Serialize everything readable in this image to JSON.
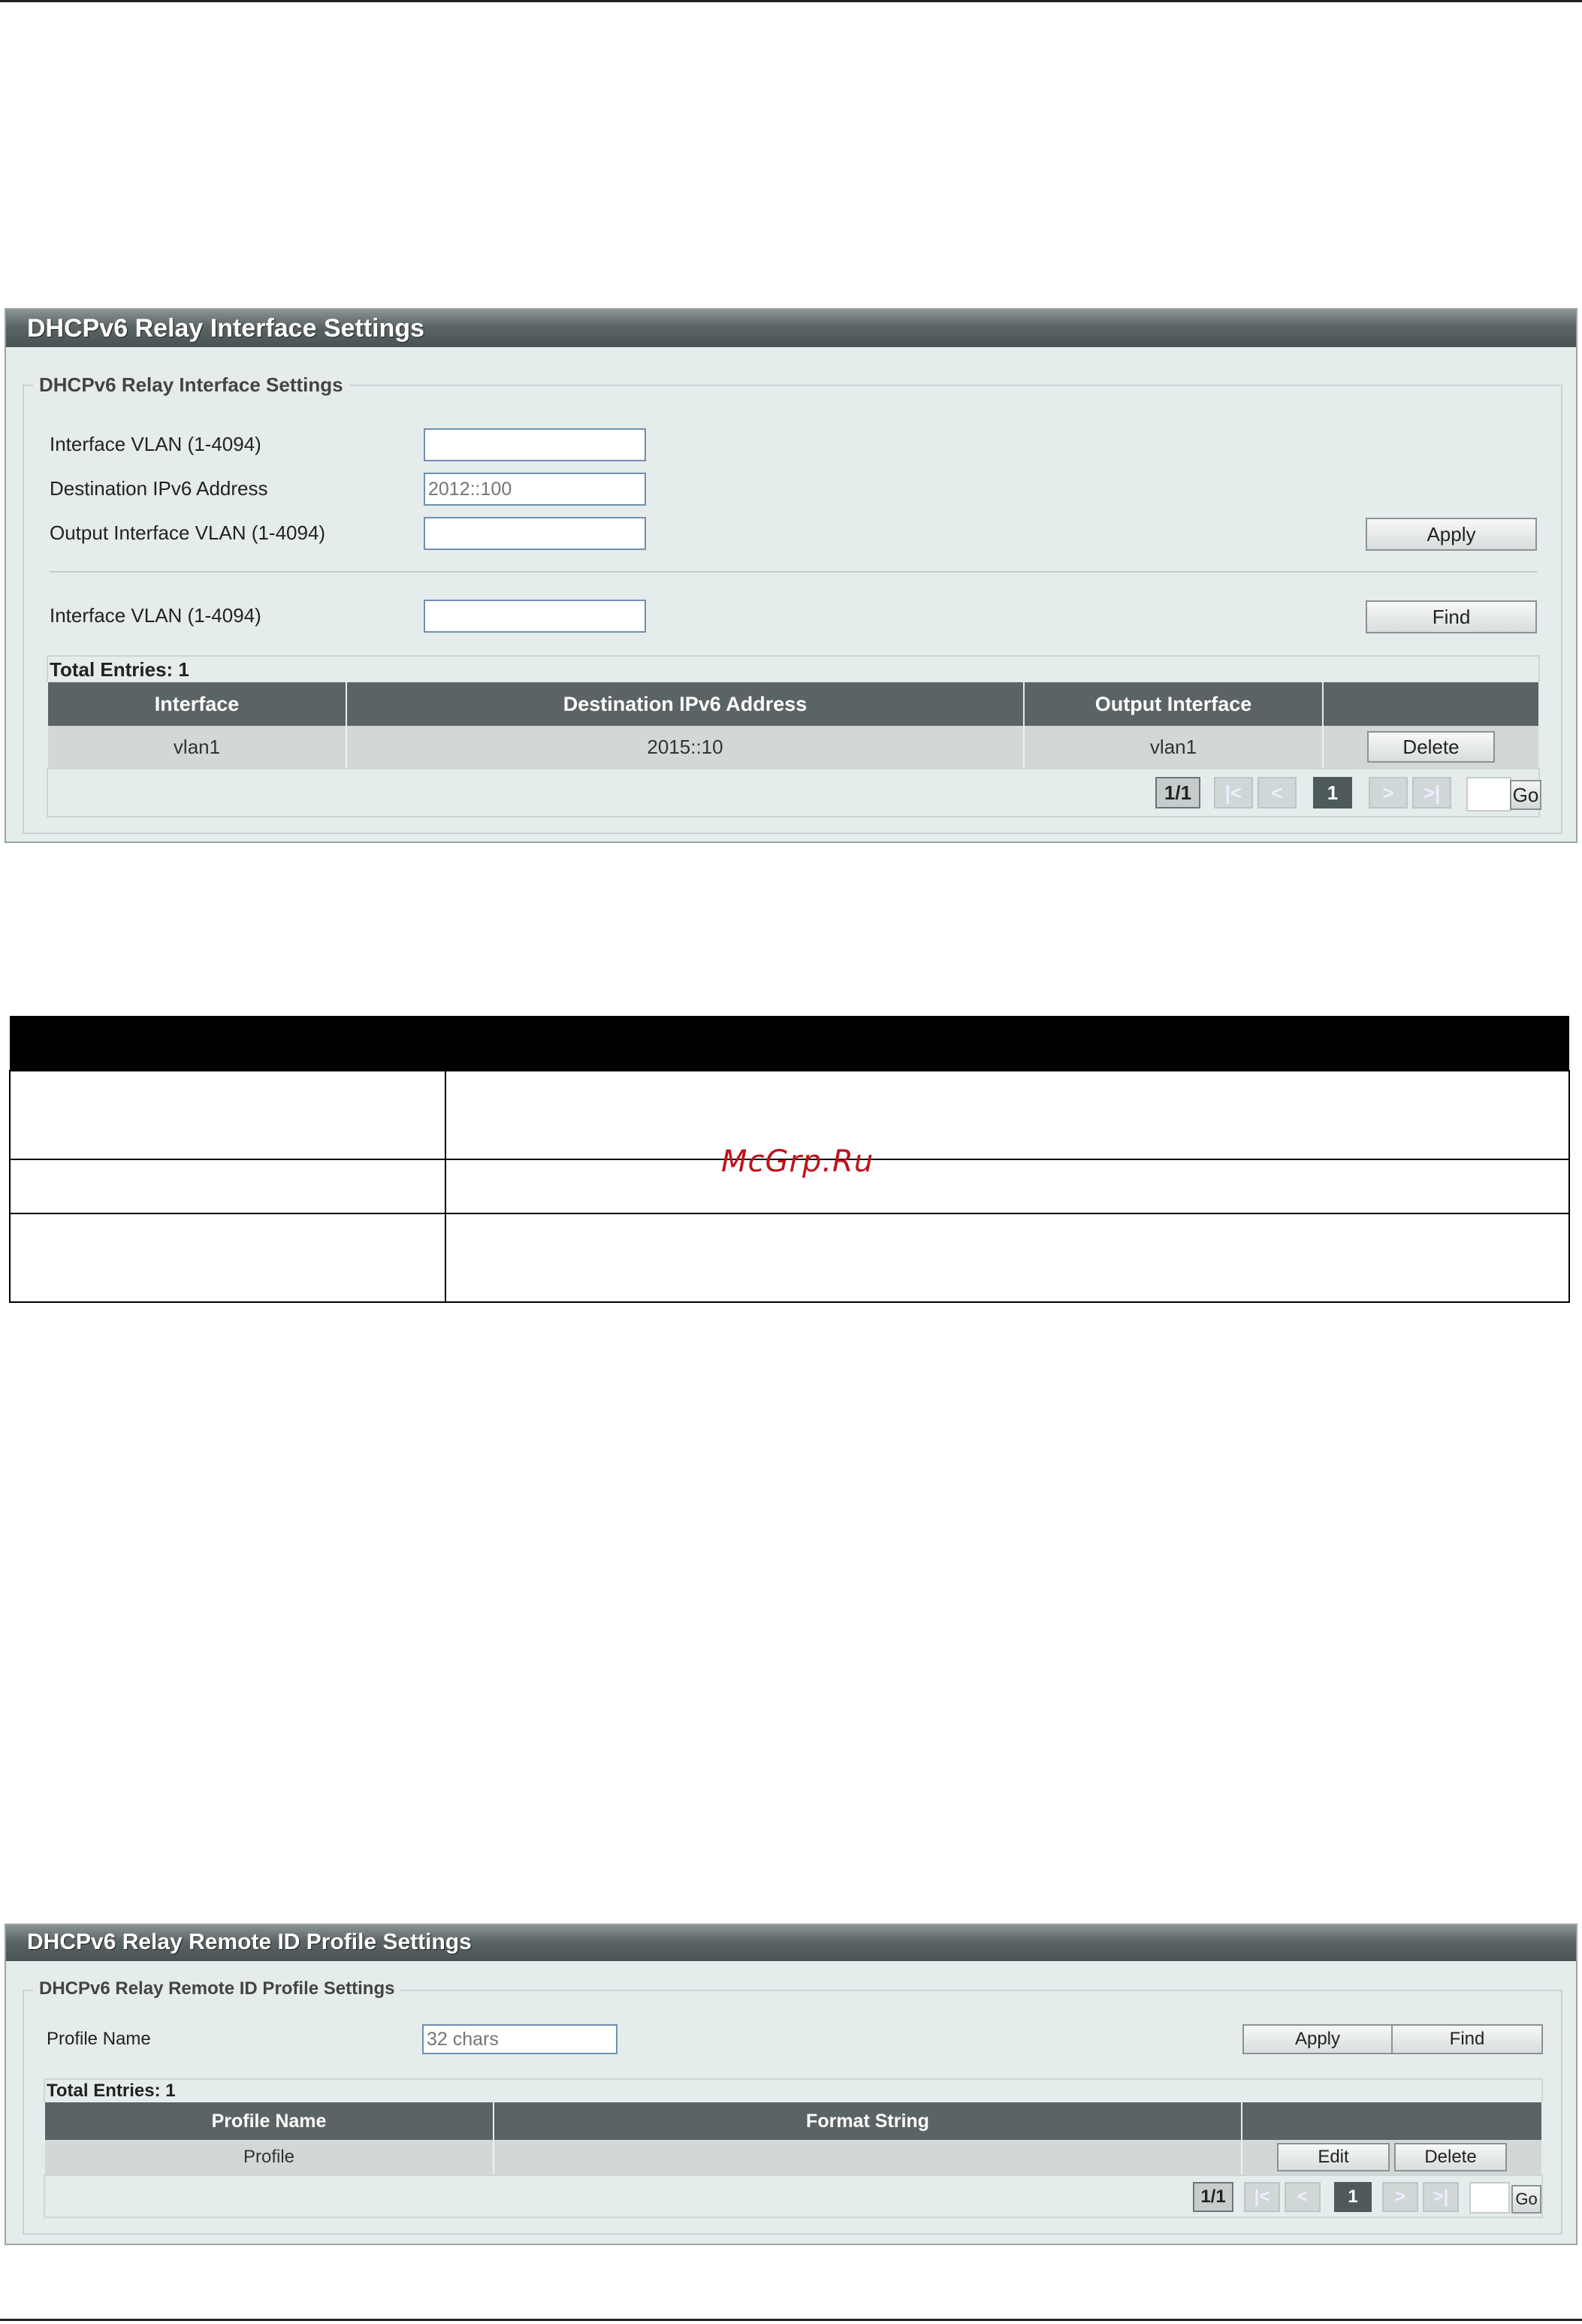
{
  "interface_panel": {
    "title": "DHCPv6 Relay Interface Settings",
    "legend": "DHCPv6 Relay Interface Settings",
    "fields": [
      {
        "label": "Interface VLAN (1-4094)",
        "value": "",
        "placeholder": ""
      },
      {
        "label": "Destination IPv6 Address",
        "value": "",
        "placeholder": "2012::100"
      },
      {
        "label": "Output Interface VLAN (1-4094)",
        "value": "",
        "placeholder": ""
      }
    ],
    "apply_label": "Apply",
    "find_field": {
      "label": "Interface VLAN (1-4094)",
      "value": "",
      "placeholder": ""
    },
    "find_label": "Find",
    "total_entries": "Total Entries: 1",
    "columns": [
      "Interface",
      "Destination IPv6 Address",
      "Output Interface",
      ""
    ],
    "rows": [
      {
        "interface": "vlan1",
        "destination": "2015::10",
        "output": "vlan1",
        "action": "Delete"
      }
    ],
    "pager": {
      "info": "1/1",
      "first": "|<",
      "prev": "<",
      "current": "1",
      "next": ">",
      "last": ">|",
      "go": "Go"
    }
  },
  "description_table": {
    "watermark": "McGrp.Ru"
  },
  "remote_id_panel": {
    "title": "DHCPv6 Relay Remote ID Profile Settings",
    "legend": "DHCPv6 Relay Remote ID Profile Settings",
    "field": {
      "label": "Profile Name",
      "value": "",
      "placeholder": "32 chars"
    },
    "apply_label": "Apply",
    "find_label": "Find",
    "total_entries": "Total Entries: 1",
    "columns": [
      "Profile Name",
      "Format String",
      ""
    ],
    "rows": [
      {
        "profile_name": "Profile",
        "format_string": "",
        "edit": "Edit",
        "delete": "Delete"
      }
    ],
    "pager": {
      "info": "1/1",
      "first": "|<",
      "prev": "<",
      "current": "1",
      "next": ">",
      "last": ">|",
      "go": "Go"
    }
  }
}
